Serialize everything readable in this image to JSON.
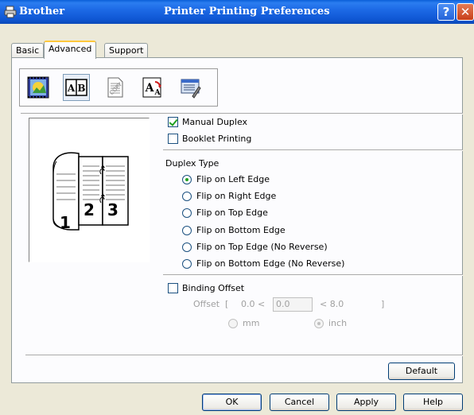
{
  "window": {
    "app_name": "Brother",
    "title": "Printer Printing Preferences",
    "help_glyph": "?",
    "close_glyph": "✕"
  },
  "tabs": [
    {
      "label": "Basic",
      "active": false
    },
    {
      "label": "Advanced",
      "active": true
    },
    {
      "label": "Support",
      "active": false
    }
  ],
  "toolbar_icons": [
    {
      "name": "print-quality-icon",
      "selected": false
    },
    {
      "name": "duplex-icon",
      "selected": true,
      "glyph": "A|B"
    },
    {
      "name": "watermark-icon",
      "selected": false
    },
    {
      "name": "page-setting-icon",
      "selected": false,
      "glyph": "A"
    },
    {
      "name": "device-options-icon",
      "selected": false
    }
  ],
  "preview": {
    "left_page": "1",
    "middle_page": "2",
    "right_page": "3"
  },
  "options": {
    "manual_duplex": {
      "label": "Manual Duplex",
      "checked": true
    },
    "booklet_printing": {
      "label": "Booklet Printing",
      "checked": false
    }
  },
  "duplex_type": {
    "heading": "Duplex Type",
    "choices": [
      {
        "label": "Flip on Left Edge",
        "selected": true
      },
      {
        "label": "Flip on Right Edge",
        "selected": false
      },
      {
        "label": "Flip on Top Edge",
        "selected": false
      },
      {
        "label": "Flip on Bottom Edge",
        "selected": false
      },
      {
        "label": "Flip on Top Edge (No Reverse)",
        "selected": false
      },
      {
        "label": "Flip on Bottom Edge (No Reverse)",
        "selected": false
      }
    ]
  },
  "binding_offset": {
    "label": "Binding Offset",
    "checked": false,
    "offset_label": "Offset",
    "open_bracket": "[",
    "min": "0.0 <",
    "value": "0.0",
    "max": "< 8.0",
    "close_bracket": "]",
    "unit_mm": "mm",
    "unit_inch": "inch",
    "selected_unit": "inch"
  },
  "buttons": {
    "default": "Default",
    "ok": "OK",
    "cancel": "Cancel",
    "apply": "Apply",
    "help": "Help"
  },
  "colors": {
    "titlebar": "#0f57d4",
    "check_mark": "#21a121",
    "tab_highlight": "#ffc83c"
  }
}
